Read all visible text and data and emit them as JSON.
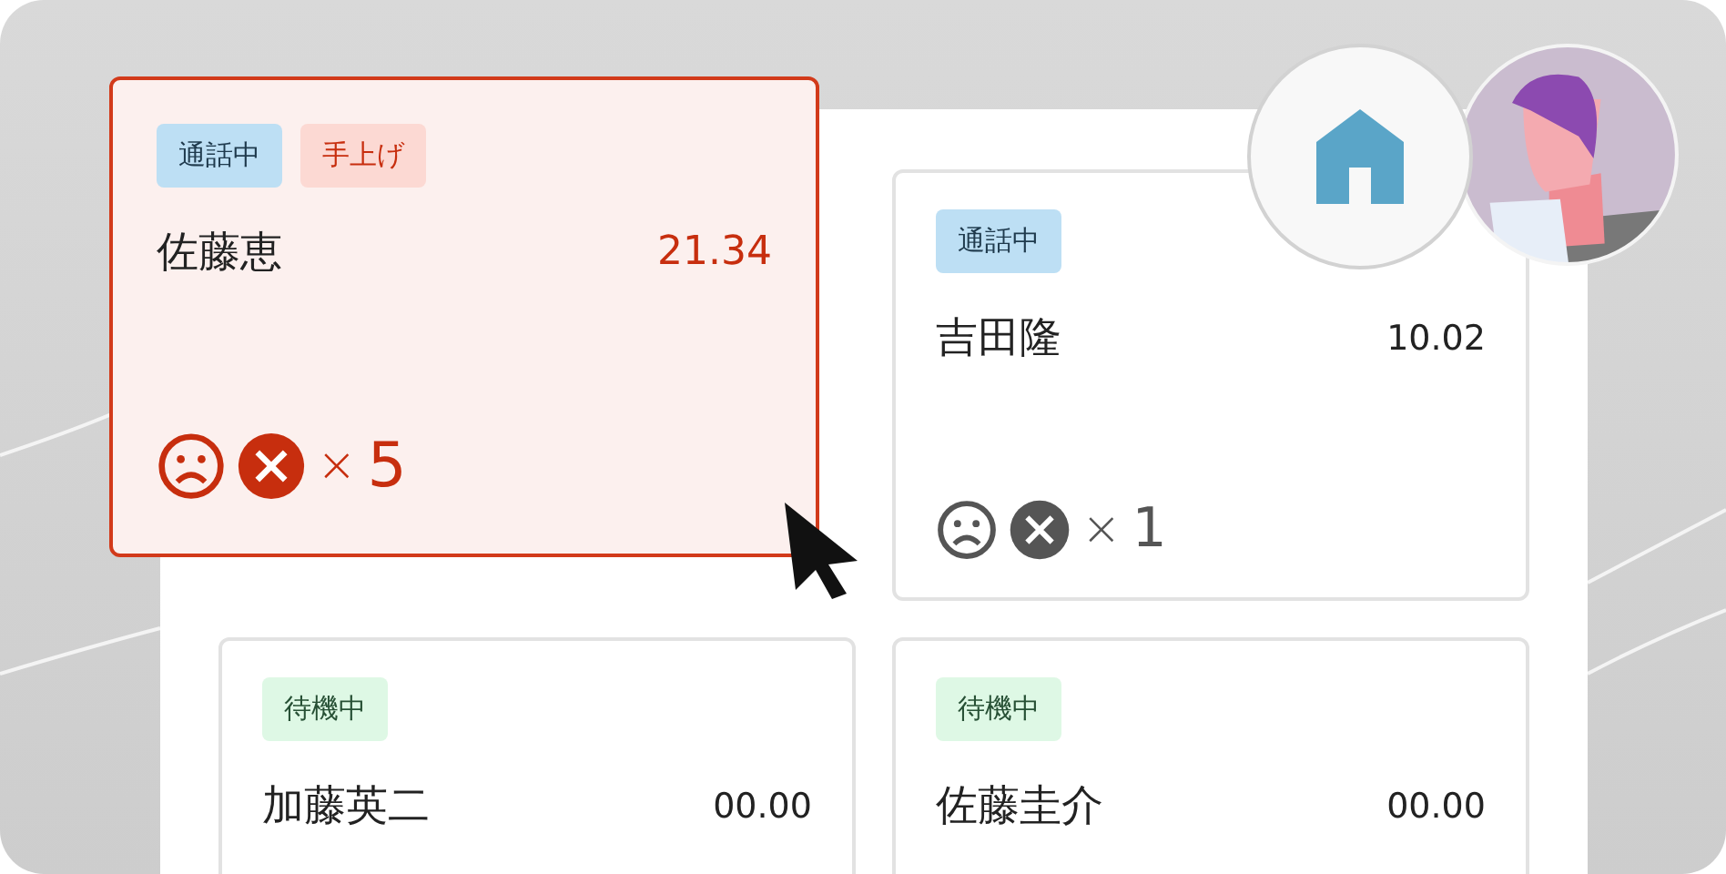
{
  "cards": [
    {
      "alert": true,
      "tags": [
        {
          "label": "通話中",
          "kind": "calling"
        },
        {
          "label": "手上げ",
          "kind": "hand"
        }
      ],
      "name": "佐藤恵",
      "time": "21.34",
      "issues": {
        "times": "×",
        "count": "5"
      }
    },
    {
      "alert": false,
      "tags": [
        {
          "label": "通話中",
          "kind": "calling"
        }
      ],
      "name": "吉田隆",
      "time": "10.02",
      "issues": {
        "times": "×",
        "count": "1"
      }
    },
    {
      "alert": false,
      "tags": [
        {
          "label": "待機中",
          "kind": "waiting"
        }
      ],
      "name": "加藤英二",
      "time": "00.00"
    },
    {
      "alert": false,
      "tags": [
        {
          "label": "待機中",
          "kind": "waiting"
        }
      ],
      "name": "佐藤圭介",
      "time": "00.00"
    }
  ]
}
